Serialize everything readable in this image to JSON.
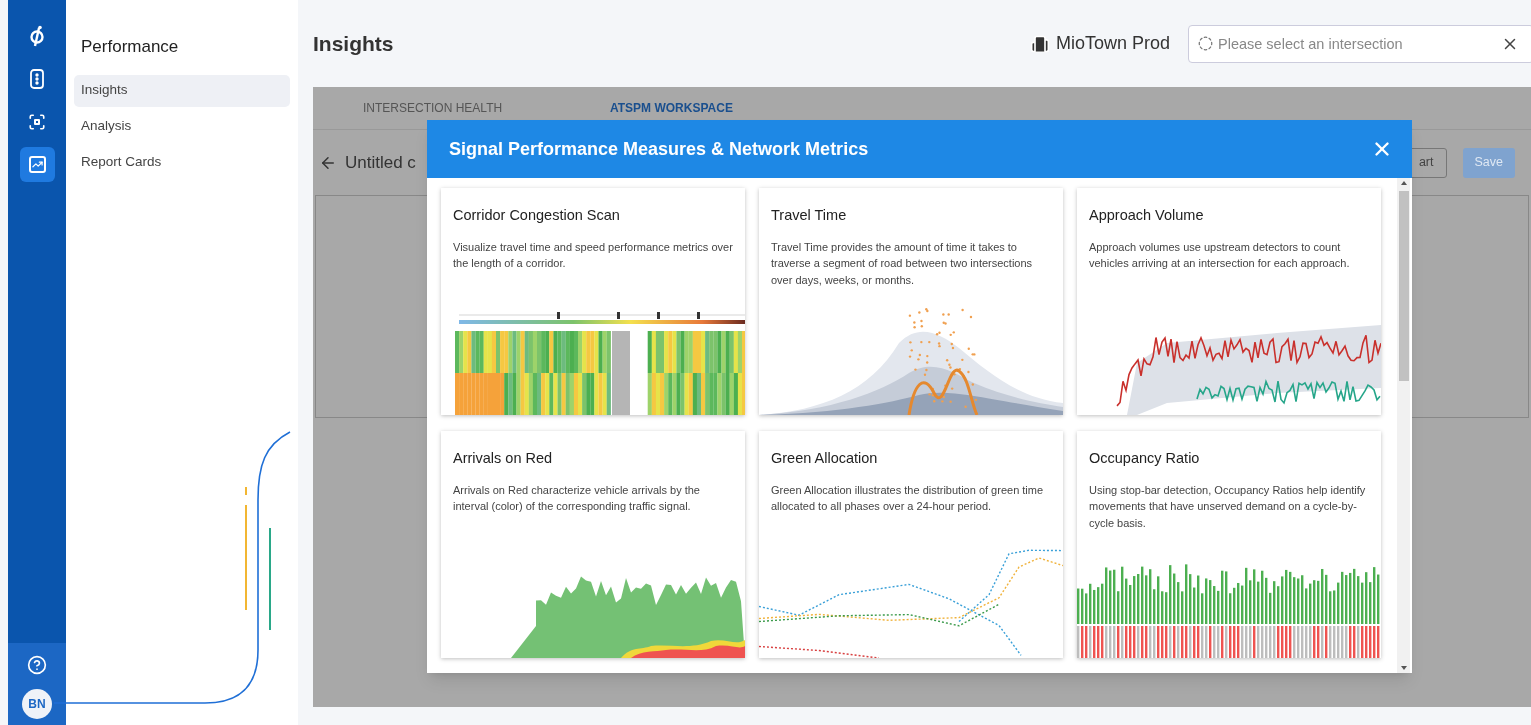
{
  "rail": {
    "items": [
      {
        "kind": "traffic-light",
        "selected": false
      },
      {
        "kind": "scan",
        "selected": false
      },
      {
        "kind": "chart",
        "selected": true
      }
    ],
    "avatar": "BN"
  },
  "nav_panel": {
    "title": "Performance",
    "items": [
      {
        "label": "Insights",
        "selected": true
      },
      {
        "label": "Analysis",
        "selected": false
      },
      {
        "label": "Report Cards",
        "selected": false
      }
    ]
  },
  "header": {
    "title": "Insights",
    "organization": "MioTown Prod",
    "search": {
      "placeholder": "Please select an intersection"
    }
  },
  "workspace": {
    "tabs": [
      {
        "label": "INTERSECTION HEALTH",
        "selected": false
      },
      {
        "label": "ATSPM WORKSPACE",
        "selected": true
      }
    ],
    "title": "Untitled c",
    "buttons": [
      {
        "label": "art",
        "disabled": false
      },
      {
        "label": "Save",
        "disabled": true
      }
    ]
  },
  "modal": {
    "title": "Signal Performance Measures & Network Metrics",
    "cards": [
      {
        "kind": "congestion",
        "title": "Corridor Congestion Scan",
        "description": "Visualize travel time and speed performance metrics over the length of a corridor."
      },
      {
        "kind": "travel",
        "title": "Travel Time",
        "description": "Travel Time provides the amount of time it takes to traverse a segment of road between two intersections over days, weeks, or months."
      },
      {
        "kind": "volume",
        "title": "Approach Volume",
        "description": "Approach volumes use upstream detectors to count vehicles arriving at an intersection for each approach."
      },
      {
        "kind": "arrivals",
        "title": "Arrivals on Red",
        "description": "Arrivals on Red characterize vehicle arrivals by the interval (color) of the corresponding traffic signal."
      },
      {
        "kind": "green",
        "title": "Green Allocation",
        "description": "Green Allocation illustrates the distribution of green time allocated to all phases over a 24-hour period."
      },
      {
        "kind": "occupancy",
        "title": "Occupancy Ratio",
        "description": "Using stop-bar detection, Occupancy Ratios help identify movements that have unserved demand on a cycle-by-cycle basis."
      }
    ]
  }
}
